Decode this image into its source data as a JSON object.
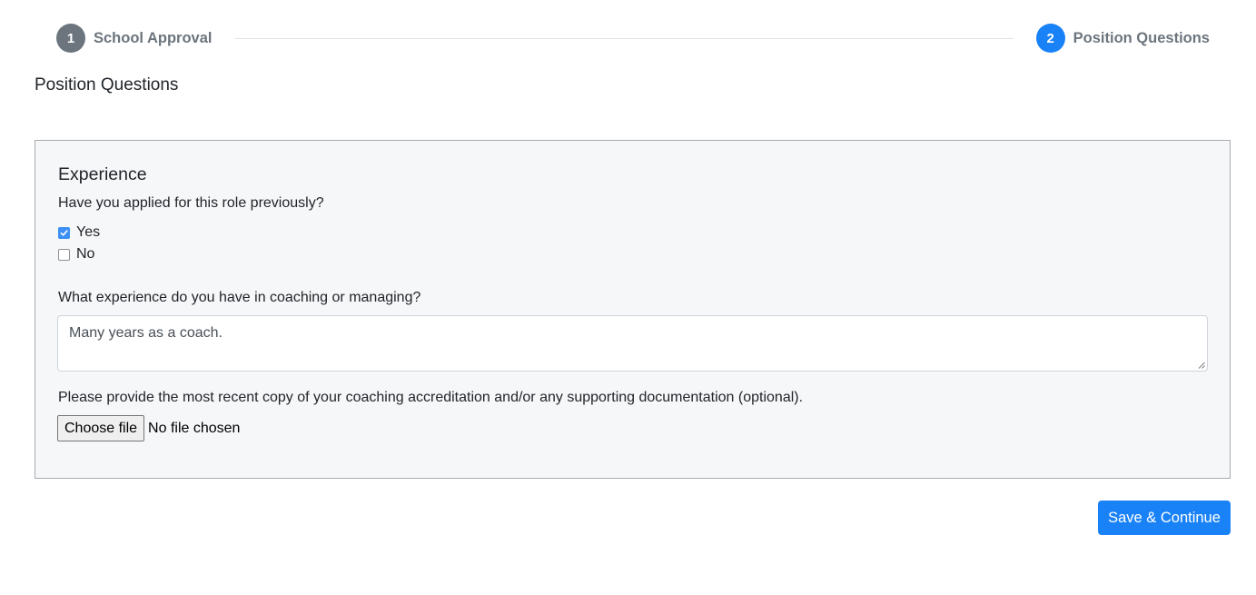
{
  "stepper": {
    "steps": [
      {
        "number": "1",
        "label": "School Approval",
        "state": "inactive"
      },
      {
        "number": "2",
        "label": "Position Questions",
        "state": "active"
      }
    ]
  },
  "page": {
    "title": "Position Questions"
  },
  "form": {
    "section_title": "Experience",
    "q1": {
      "label": "Have you applied for this role previously?",
      "options": [
        {
          "label": "Yes",
          "checked": true
        },
        {
          "label": "No",
          "checked": false
        }
      ]
    },
    "q2": {
      "label": "What experience do you have in coaching or managing?",
      "value": "Many years as a coach."
    },
    "q3": {
      "label": "Please provide the most recent copy of your coaching accreditation and/or any supporting documentation (optional).",
      "button_label": "Choose file",
      "status": "No file chosen"
    }
  },
  "actions": {
    "save_label": "Save & Continue"
  },
  "colors": {
    "primary": "#1a82f7",
    "inactive_step": "#6c757d",
    "panel_bg": "#f6f7f9"
  }
}
